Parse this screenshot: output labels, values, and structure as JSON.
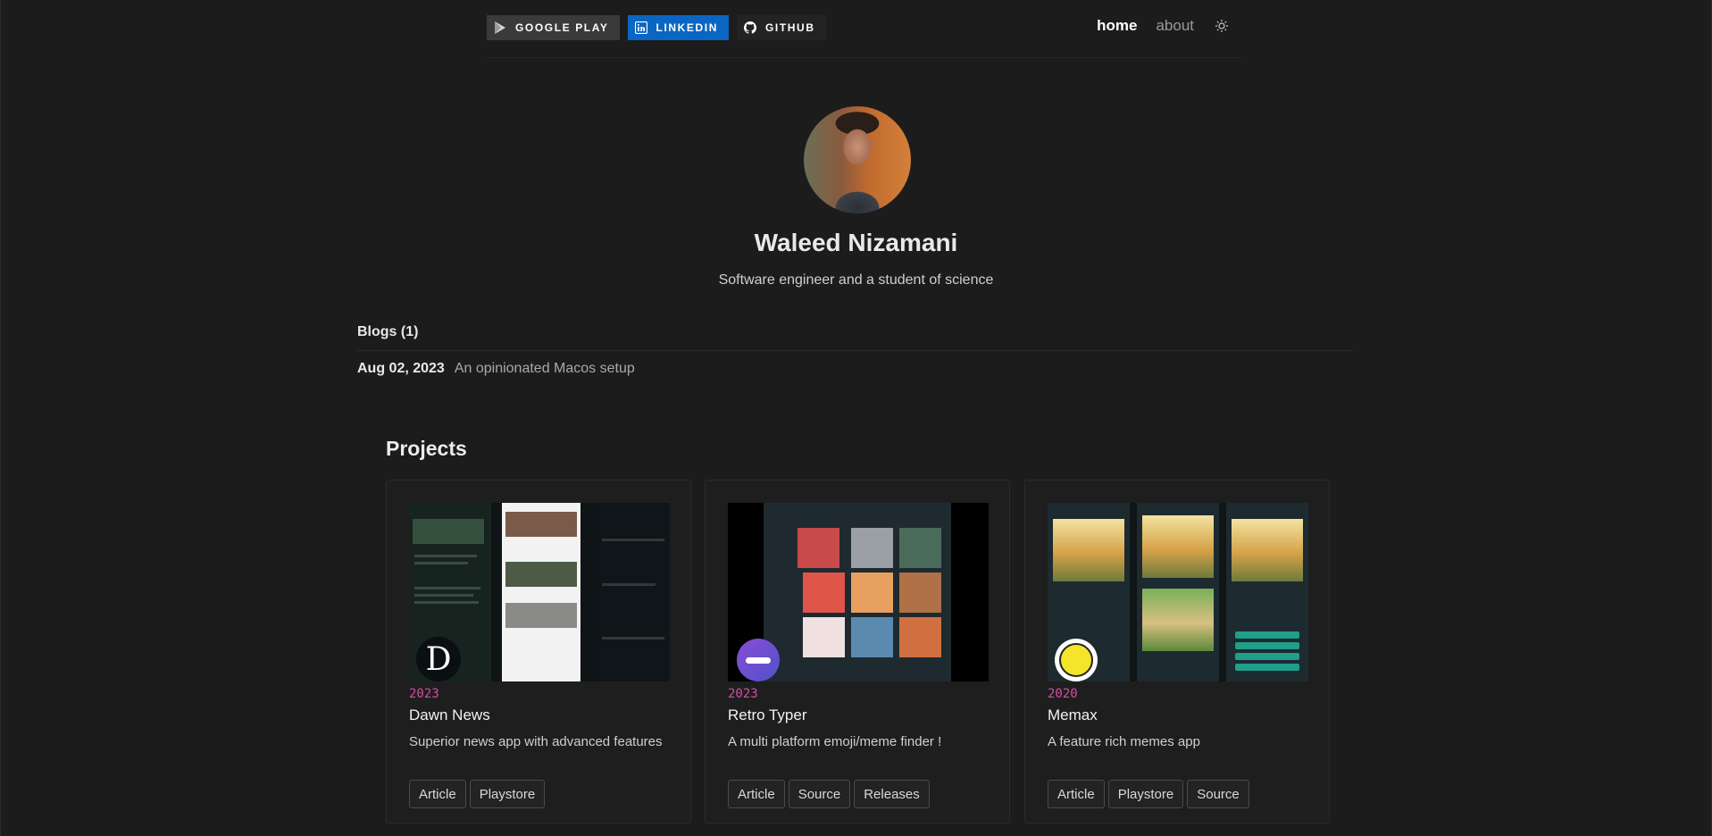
{
  "header": {
    "badges": [
      {
        "label": "GOOGLE PLAY",
        "icon": "google-play-icon"
      },
      {
        "label": "LINKEDIN",
        "icon": "linkedin-icon",
        "color": "#0a66c2"
      },
      {
        "label": "GITHUB",
        "icon": "github-icon"
      }
    ],
    "nav": [
      {
        "label": "home",
        "active": true
      },
      {
        "label": "about",
        "active": false
      }
    ],
    "theme_toggle_icon": "sun-icon"
  },
  "profile": {
    "name": "Waleed Nizamani",
    "tagline": "Software engineer and a student of science"
  },
  "blogs": {
    "heading": "Blogs (1)",
    "items": [
      {
        "date": "Aug 02, 2023",
        "title": "An opinionated Macos setup"
      }
    ]
  },
  "projects": {
    "heading": "Projects",
    "accent_color": "#d04ea4",
    "items": [
      {
        "year": "2023",
        "title": "Dawn News",
        "description": "Superior news app with advanced features",
        "logo_letter": "D",
        "buttons": [
          "Article",
          "Playstore"
        ]
      },
      {
        "year": "2023",
        "title": "Retro Typer",
        "description": "A multi platform emoji/meme finder !",
        "buttons": [
          "Article",
          "Source",
          "Releases"
        ]
      },
      {
        "year": "2020",
        "title": "Memax",
        "description": "A feature rich memes app",
        "buttons": [
          "Article",
          "Playstore",
          "Source"
        ]
      }
    ]
  }
}
